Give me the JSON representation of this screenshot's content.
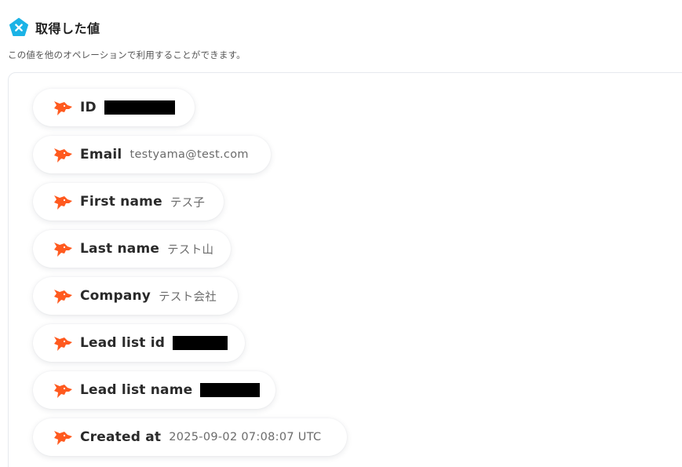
{
  "section": {
    "title": "取得した値",
    "description": "この値を他のオペレーションで利用することができます。",
    "icon": "yoom-pentagon-icon",
    "icon_color": "#1bb3e6"
  },
  "field_icon": {
    "name": "fox-head-icon",
    "color": "#ff5a1f"
  },
  "fields": [
    {
      "label": "ID",
      "value": "",
      "redacted": true
    },
    {
      "label": "Email",
      "value": "testyama@test.com",
      "redacted": false
    },
    {
      "label": "First name",
      "value": "テス子",
      "redacted": false
    },
    {
      "label": "Last name",
      "value": "テスト山",
      "redacted": false
    },
    {
      "label": "Company",
      "value": "テスト会社",
      "redacted": false
    },
    {
      "label": "Lead list id",
      "value": "",
      "redacted": true
    },
    {
      "label": "Lead list name",
      "value": "",
      "redacted": true
    },
    {
      "label": "Created at",
      "value": "2025-09-02 07:08:07 UTC",
      "redacted": false
    }
  ]
}
